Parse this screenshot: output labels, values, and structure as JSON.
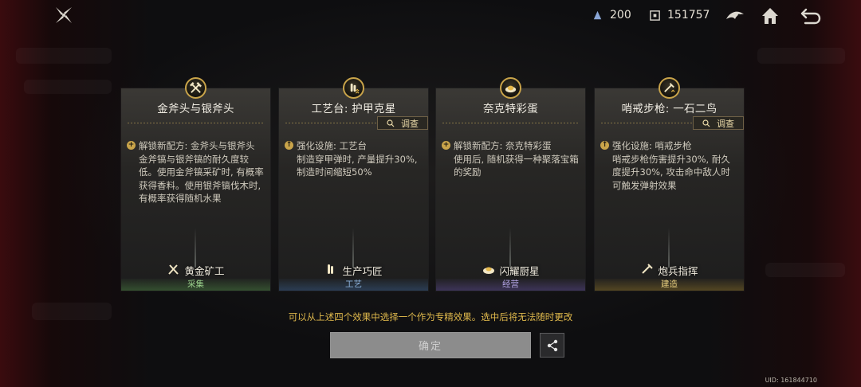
{
  "topbar": {
    "logo_icon": "shuriken-logo-icon",
    "resources": [
      {
        "icon": "crystal-icon",
        "value": "200"
      },
      {
        "icon": "coin-frame-icon",
        "value": "151757"
      }
    ],
    "icons": [
      "bird-emblem-icon",
      "home-icon",
      "back-arrow-icon"
    ]
  },
  "cards": [
    {
      "badge_icon": "pickaxe-axe-icon",
      "title": "金斧头与银斧头",
      "has_inspect": false,
      "lead": "解锁新配方: 金斧头与银斧头",
      "body": "金斧镐与银斧镐的耐久度较低。使用金斧镐采矿时, 有概率获得香料。使用银斧镐伐木时, 有概率获得随机水果",
      "skill": "黄金矿工",
      "skill_icon": "pickaxe-axe-icon",
      "category": "采集"
    },
    {
      "badge_icon": "ammo-upgrade-icon",
      "title": "工艺台: 护甲克星",
      "has_inspect": true,
      "lead": "强化设施: 工艺台",
      "body": "制造穿甲弹时, 产量提升30%, 制造时间缩短50%",
      "skill": "生产巧匠",
      "skill_icon": "ammo-upgrade-icon",
      "category": "工艺"
    },
    {
      "badge_icon": "egg-dish-icon",
      "title": "奈克特彩蛋",
      "has_inspect": false,
      "lead": "解锁新配方: 奈克特彩蛋",
      "body": "使用后, 随机获得一种聚落宝箱的奖励",
      "skill": "闪耀厨星",
      "skill_icon": "egg-dish-icon",
      "category": "经营"
    },
    {
      "badge_icon": "rifle-upgrade-icon",
      "title": "哨戒步枪: 一石二鸟",
      "has_inspect": true,
      "lead": "强化设施: 哨戒步枪",
      "body": "哨戒步枪伤害提升30%, 耐久度提升30%, 攻击命中敌人时可触发弹射效果",
      "skill": "炮兵指挥",
      "skill_icon": "rifle-upgrade-icon",
      "category": "建造"
    }
  ],
  "inspect_label": "调查",
  "hint": "可以从上述四个效果中选择一个作为专精效果。选中后将无法随时更改",
  "confirm_label": "确定",
  "share_icon": "share-icon",
  "uid": "UID: 161844710",
  "colors": {
    "accent_gold": "#c9a44a",
    "hint_text": "#e0b94c",
    "cat_gather": "#9ad08b",
    "cat_craft": "#8fb6e0",
    "cat_business": "#b5a6e6",
    "cat_build": "#e8cf7f"
  }
}
